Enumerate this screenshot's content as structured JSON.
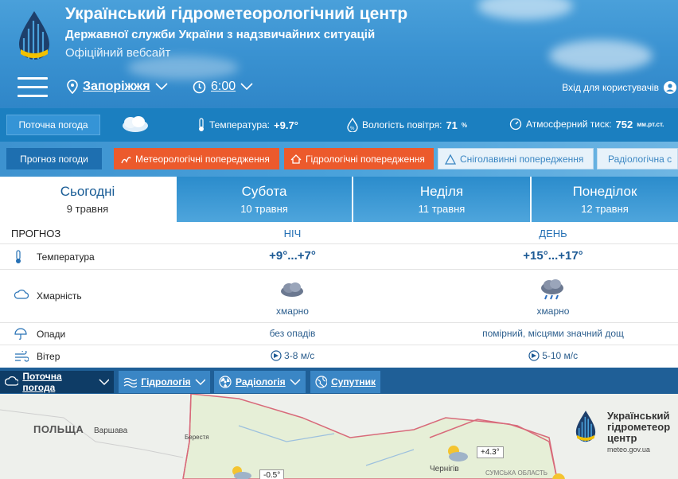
{
  "header": {
    "title": "Український гідрометеорологічний центр",
    "subtitle": "Державної служби України з надзвичайних ситуацій",
    "tagline": "Офіційний вебсайт",
    "city": "Запоріжжя",
    "time": "6:00",
    "login": "Вхід для користувачів"
  },
  "current": {
    "button": "Поточна погода",
    "temp_label": "Температура:",
    "temp_value": "+9.7°",
    "humidity_label": "Вологість повітря:",
    "humidity_value": "71",
    "humidity_unit": "%",
    "pressure_label": "Атмосферний тиск:",
    "pressure_value": "752",
    "pressure_unit": "мм.рт.ст."
  },
  "warnings": {
    "forecast": "Прогноз погоди",
    "meteo": "Метеорологічні попередження",
    "hydro": "Гідрологічні попередження",
    "avalanche": "Сніголавинні попередження",
    "radio": "Радіологічна с"
  },
  "tabs": [
    {
      "day": "Сьогодні",
      "date": "9 травня"
    },
    {
      "day": "Субота",
      "date": "10 травня"
    },
    {
      "day": "Неділя",
      "date": "11 травня"
    },
    {
      "day": "Понеділок",
      "date": "12 травня"
    }
  ],
  "forecast": {
    "header": "ПРОГНОЗ",
    "night": "НІЧ",
    "day": "ДЕНЬ",
    "temp_label": "Температура",
    "temp_night": "+9°...+7°",
    "temp_day": "+15°...+17°",
    "cloud_label": "Хмарність",
    "cloud_night": "хмарно",
    "cloud_day": "хмарно",
    "precip_label": "Опади",
    "precip_night": "без опадів",
    "precip_day": "помірний, місцями значний дощ",
    "wind_label": "Вітер",
    "wind_night": "3-8 м/с",
    "wind_day": "5-10 м/с"
  },
  "bottom_nav": {
    "current": "Поточна погода",
    "hydrology": "Гідрологія",
    "radiology": "Радіологія",
    "satellite": "Супутник"
  },
  "map": {
    "poland": "ПОЛЬЩА",
    "warsaw": "Варшава",
    "brest": "Берестя",
    "chernihiv": "Чернігів",
    "sumy_region": "СУМСЬКА ОБЛАСТЬ",
    "temp1": "+4.3°",
    "temp2": "-0.5°",
    "brand_title": "Український гідрометеор центр",
    "brand_url": "meteo.gov.ua"
  }
}
